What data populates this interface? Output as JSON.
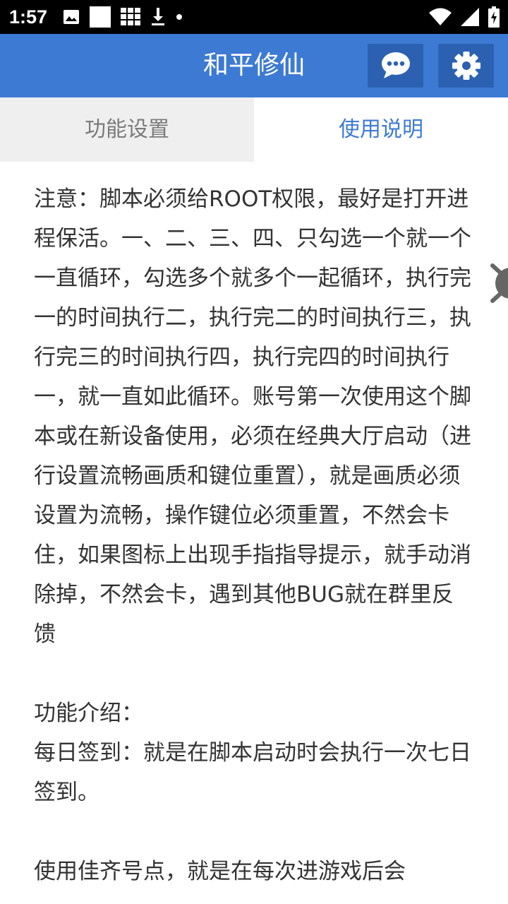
{
  "status_bar": {
    "time": "1:57",
    "left_icons": [
      "image-icon",
      "square-icon",
      "grid-icon",
      "download-icon",
      "dot-icon"
    ],
    "right_icons": [
      "wifi-icon",
      "signal-icon",
      "battery-charging-icon"
    ]
  },
  "app_bar": {
    "title": "和平修仙",
    "chat_icon": "chat-bubble-icon",
    "settings_icon": "gear-icon"
  },
  "tabs": [
    {
      "label": "功能设置",
      "active": false
    },
    {
      "label": "使用说明",
      "active": true
    }
  ],
  "content": {
    "notice": "注意：脚本必须给ROOT权限，最好是打开进程保活。一、二、三、四、只勾选一个就一个一直循环，勾选多个就多个一起循环，执行完一的时间执行二，执行完二的时间执行三，执行完三的时间执行四，执行完四的时间执行一，就一直如此循环。账号第一次使用这个脚本或在新设备使用，必须在经典大厅启动（进行设置流畅画质和键位重置），就是画质必须设置为流畅，操作键位必须重置，不然会卡住，如果图标上出现手指指导提示，就手动消除掉，不然会卡，遇到其他BUG就在群里反馈",
    "feature_heading": "功能介绍：",
    "daily_checkin": "每日签到：就是在脚本启动时会执行一次七日签到。",
    "partial_next": "使用佳齐号点，就是在每次进游戏后会"
  },
  "colors": {
    "primary": "#3d7ad4",
    "primary_dark": "#2c61b2",
    "tab_inactive_bg": "#efefef"
  }
}
